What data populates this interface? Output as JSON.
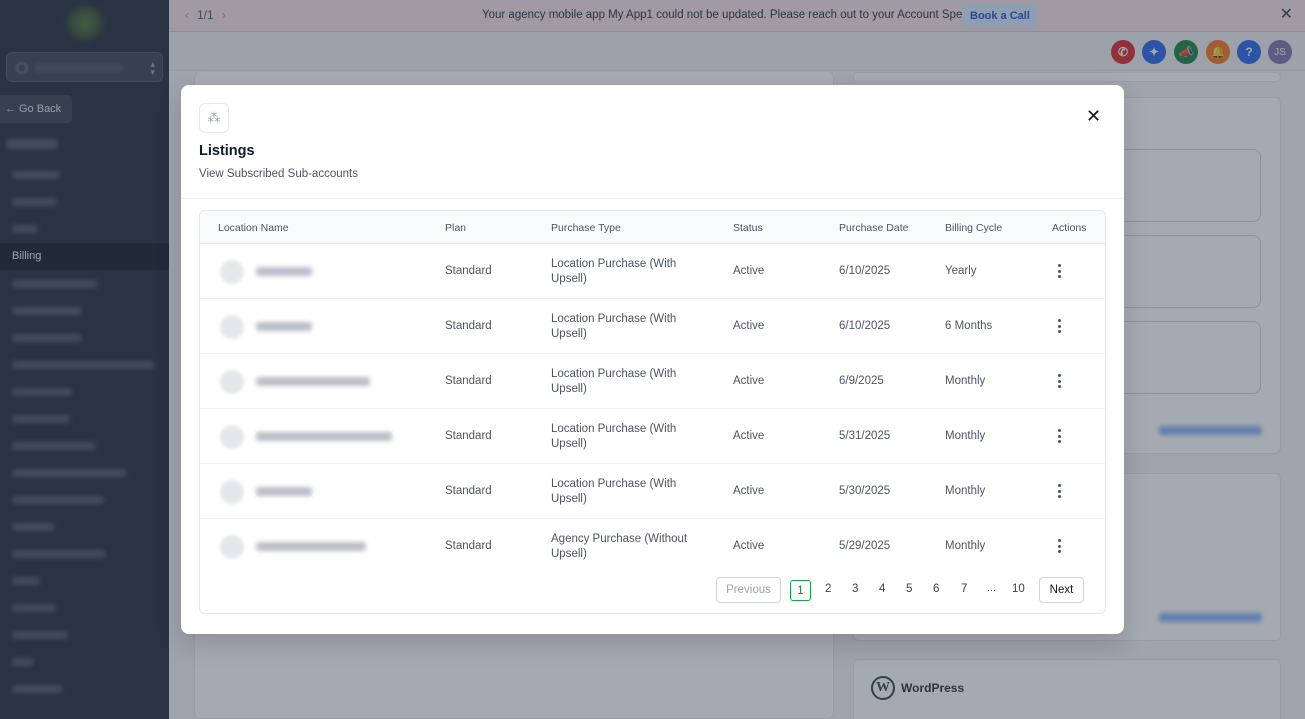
{
  "banner": {
    "pager": "1/1",
    "message": "Your agency mobile app My App1 could not be updated. Please reach out to your Account Specialist.",
    "cta": "Book a Call"
  },
  "header": {
    "avatar_initials": "JS",
    "help_glyph": "?"
  },
  "sidebar": {
    "go_back": "Go Back",
    "active_item": "Billing"
  },
  "background": {
    "wordpress_label": "WordPress"
  },
  "modal": {
    "title": "Listings",
    "subtitle": "View Subscribed Sub-accounts",
    "columns": [
      "Location Name",
      "Plan",
      "Purchase Type",
      "Status",
      "Purchase Date",
      "Billing Cycle",
      "Actions"
    ],
    "rows": [
      {
        "plan": "Standard",
        "purchase_type_1": "Location Purchase (With",
        "purchase_type_2": "Upsell)",
        "status": "Active",
        "date": "6/10/2025",
        "cycle": "Yearly"
      },
      {
        "plan": "Standard",
        "purchase_type_1": "Location Purchase (With",
        "purchase_type_2": "Upsell)",
        "status": "Active",
        "date": "6/10/2025",
        "cycle": "6 Months"
      },
      {
        "plan": "Standard",
        "purchase_type_1": "Location Purchase (With",
        "purchase_type_2": "Upsell)",
        "status": "Active",
        "date": "6/9/2025",
        "cycle": "Monthly"
      },
      {
        "plan": "Standard",
        "purchase_type_1": "Location Purchase (With",
        "purchase_type_2": "Upsell)",
        "status": "Active",
        "date": "5/31/2025",
        "cycle": "Monthly"
      },
      {
        "plan": "Standard",
        "purchase_type_1": "Location Purchase (With",
        "purchase_type_2": "Upsell)",
        "status": "Active",
        "date": "5/30/2025",
        "cycle": "Monthly"
      },
      {
        "plan": "Standard",
        "purchase_type_1": "Agency Purchase (Without",
        "purchase_type_2": "Upsell)",
        "status": "Active",
        "date": "5/29/2025",
        "cycle": "Monthly"
      }
    ],
    "pagination": {
      "previous": "Previous",
      "next": "Next",
      "current": "1",
      "pages": [
        "2",
        "3",
        "4",
        "5",
        "6",
        "7"
      ],
      "ellipsis": "···",
      "last": "10"
    }
  }
}
